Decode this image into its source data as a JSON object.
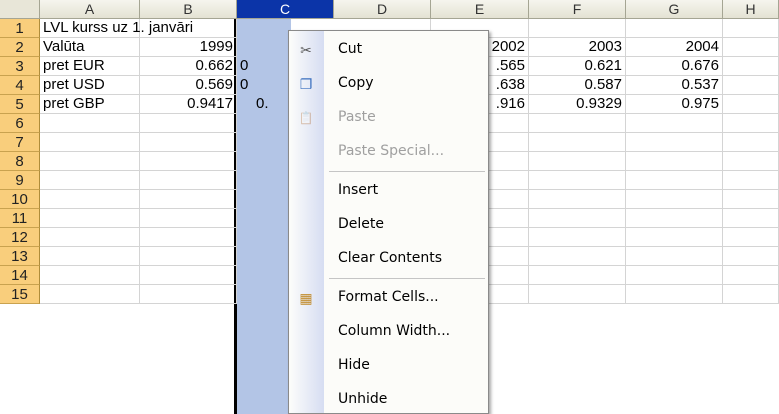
{
  "sheet": {
    "columns": [
      "A",
      "B",
      "C",
      "D",
      "E",
      "F",
      "G",
      "H"
    ],
    "selected_column": "C",
    "rows": [
      "1",
      "2",
      "3",
      "4",
      "5",
      "6",
      "7",
      "8",
      "9",
      "10",
      "11",
      "12",
      "13",
      "14",
      "15"
    ],
    "cells": {
      "A1": "LVL kurss uz 1. janvāri",
      "A2": "Valūta",
      "B2": "1999",
      "E2": "2002",
      "F2": "2003",
      "G2": "2004",
      "A3": "pret EUR",
      "B3": "0.662",
      "C3": "0",
      "E3": ".565",
      "F3": "0.621",
      "G3": "0.676",
      "A4": "pret USD",
      "B4": "0.569",
      "C4": "0",
      "E4": ".638",
      "F4": "0.587",
      "G4": "0.537",
      "A5": "pret GBP",
      "B5": "0.9417",
      "C5": "0.",
      "E5": ".916",
      "F5": "0.9329",
      "G5": "0.975"
    }
  },
  "context_menu": {
    "items": [
      {
        "label": "Cut",
        "icon": "scissors-icon",
        "glyph": "✂",
        "enabled": true
      },
      {
        "label": "Copy",
        "icon": "copy-icon",
        "glyph": "❐",
        "enabled": true
      },
      {
        "label": "Paste",
        "icon": "paste-icon",
        "glyph": "📋",
        "enabled": false
      },
      {
        "label": "Paste Special...",
        "icon": "",
        "glyph": "",
        "enabled": false
      },
      {
        "label": "Insert",
        "icon": "",
        "glyph": "",
        "enabled": true
      },
      {
        "label": "Delete",
        "icon": "",
        "glyph": "",
        "enabled": true
      },
      {
        "label": "Clear Contents",
        "icon": "",
        "glyph": "",
        "enabled": true
      },
      {
        "label": "Format Cells...",
        "icon": "format-cells-icon",
        "glyph": "▦",
        "enabled": true
      },
      {
        "label": "Column Width...",
        "icon": "",
        "glyph": "",
        "enabled": true
      },
      {
        "label": "Hide",
        "icon": "",
        "glyph": "",
        "enabled": true
      },
      {
        "label": "Unhide",
        "icon": "",
        "glyph": "",
        "enabled": true
      }
    ]
  },
  "colors": {
    "selected_header": "#0b34a8",
    "selected_column_fill": "#b3c5e6",
    "row_header": "#f9ce7c"
  }
}
